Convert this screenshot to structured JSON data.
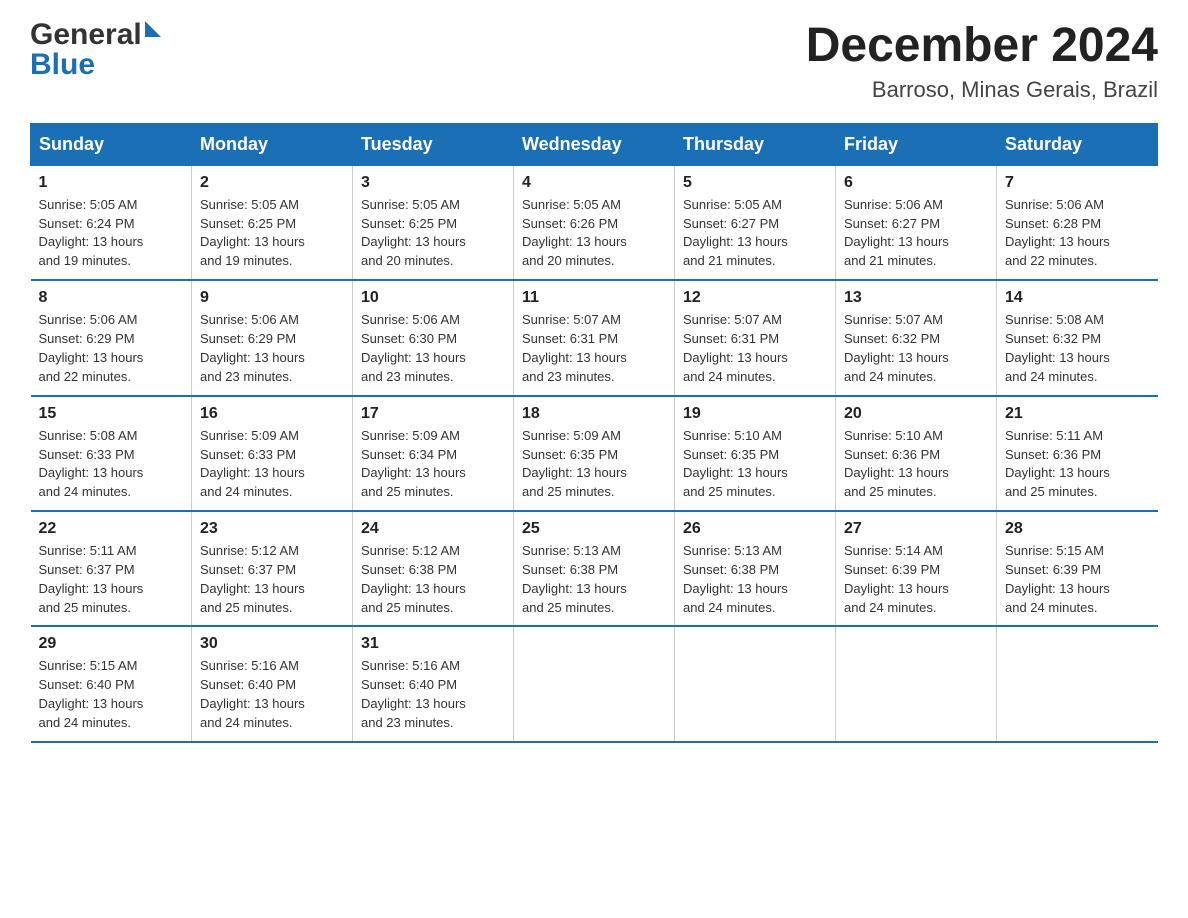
{
  "header": {
    "logo_text_general": "General",
    "logo_text_blue": "Blue",
    "month_title": "December 2024",
    "location": "Barroso, Minas Gerais, Brazil"
  },
  "days_of_week": [
    "Sunday",
    "Monday",
    "Tuesday",
    "Wednesday",
    "Thursday",
    "Friday",
    "Saturday"
  ],
  "weeks": [
    [
      {
        "day": "1",
        "sunrise": "5:05 AM",
        "sunset": "6:24 PM",
        "daylight": "13 hours and 19 minutes."
      },
      {
        "day": "2",
        "sunrise": "5:05 AM",
        "sunset": "6:25 PM",
        "daylight": "13 hours and 19 minutes."
      },
      {
        "day": "3",
        "sunrise": "5:05 AM",
        "sunset": "6:25 PM",
        "daylight": "13 hours and 20 minutes."
      },
      {
        "day": "4",
        "sunrise": "5:05 AM",
        "sunset": "6:26 PM",
        "daylight": "13 hours and 20 minutes."
      },
      {
        "day": "5",
        "sunrise": "5:05 AM",
        "sunset": "6:27 PM",
        "daylight": "13 hours and 21 minutes."
      },
      {
        "day": "6",
        "sunrise": "5:06 AM",
        "sunset": "6:27 PM",
        "daylight": "13 hours and 21 minutes."
      },
      {
        "day": "7",
        "sunrise": "5:06 AM",
        "sunset": "6:28 PM",
        "daylight": "13 hours and 22 minutes."
      }
    ],
    [
      {
        "day": "8",
        "sunrise": "5:06 AM",
        "sunset": "6:29 PM",
        "daylight": "13 hours and 22 minutes."
      },
      {
        "day": "9",
        "sunrise": "5:06 AM",
        "sunset": "6:29 PM",
        "daylight": "13 hours and 23 minutes."
      },
      {
        "day": "10",
        "sunrise": "5:06 AM",
        "sunset": "6:30 PM",
        "daylight": "13 hours and 23 minutes."
      },
      {
        "day": "11",
        "sunrise": "5:07 AM",
        "sunset": "6:31 PM",
        "daylight": "13 hours and 23 minutes."
      },
      {
        "day": "12",
        "sunrise": "5:07 AM",
        "sunset": "6:31 PM",
        "daylight": "13 hours and 24 minutes."
      },
      {
        "day": "13",
        "sunrise": "5:07 AM",
        "sunset": "6:32 PM",
        "daylight": "13 hours and 24 minutes."
      },
      {
        "day": "14",
        "sunrise": "5:08 AM",
        "sunset": "6:32 PM",
        "daylight": "13 hours and 24 minutes."
      }
    ],
    [
      {
        "day": "15",
        "sunrise": "5:08 AM",
        "sunset": "6:33 PM",
        "daylight": "13 hours and 24 minutes."
      },
      {
        "day": "16",
        "sunrise": "5:09 AM",
        "sunset": "6:33 PM",
        "daylight": "13 hours and 24 minutes."
      },
      {
        "day": "17",
        "sunrise": "5:09 AM",
        "sunset": "6:34 PM",
        "daylight": "13 hours and 25 minutes."
      },
      {
        "day": "18",
        "sunrise": "5:09 AM",
        "sunset": "6:35 PM",
        "daylight": "13 hours and 25 minutes."
      },
      {
        "day": "19",
        "sunrise": "5:10 AM",
        "sunset": "6:35 PM",
        "daylight": "13 hours and 25 minutes."
      },
      {
        "day": "20",
        "sunrise": "5:10 AM",
        "sunset": "6:36 PM",
        "daylight": "13 hours and 25 minutes."
      },
      {
        "day": "21",
        "sunrise": "5:11 AM",
        "sunset": "6:36 PM",
        "daylight": "13 hours and 25 minutes."
      }
    ],
    [
      {
        "day": "22",
        "sunrise": "5:11 AM",
        "sunset": "6:37 PM",
        "daylight": "13 hours and 25 minutes."
      },
      {
        "day": "23",
        "sunrise": "5:12 AM",
        "sunset": "6:37 PM",
        "daylight": "13 hours and 25 minutes."
      },
      {
        "day": "24",
        "sunrise": "5:12 AM",
        "sunset": "6:38 PM",
        "daylight": "13 hours and 25 minutes."
      },
      {
        "day": "25",
        "sunrise": "5:13 AM",
        "sunset": "6:38 PM",
        "daylight": "13 hours and 25 minutes."
      },
      {
        "day": "26",
        "sunrise": "5:13 AM",
        "sunset": "6:38 PM",
        "daylight": "13 hours and 24 minutes."
      },
      {
        "day": "27",
        "sunrise": "5:14 AM",
        "sunset": "6:39 PM",
        "daylight": "13 hours and 24 minutes."
      },
      {
        "day": "28",
        "sunrise": "5:15 AM",
        "sunset": "6:39 PM",
        "daylight": "13 hours and 24 minutes."
      }
    ],
    [
      {
        "day": "29",
        "sunrise": "5:15 AM",
        "sunset": "6:40 PM",
        "daylight": "13 hours and 24 minutes."
      },
      {
        "day": "30",
        "sunrise": "5:16 AM",
        "sunset": "6:40 PM",
        "daylight": "13 hours and 24 minutes."
      },
      {
        "day": "31",
        "sunrise": "5:16 AM",
        "sunset": "6:40 PM",
        "daylight": "13 hours and 23 minutes."
      },
      null,
      null,
      null,
      null
    ]
  ],
  "labels": {
    "sunrise": "Sunrise:",
    "sunset": "Sunset:",
    "daylight": "Daylight:"
  },
  "colors": {
    "header_bg": "#1a6fb5",
    "border": "#1a6fb5",
    "text_dark": "#222",
    "text_body": "#333"
  }
}
